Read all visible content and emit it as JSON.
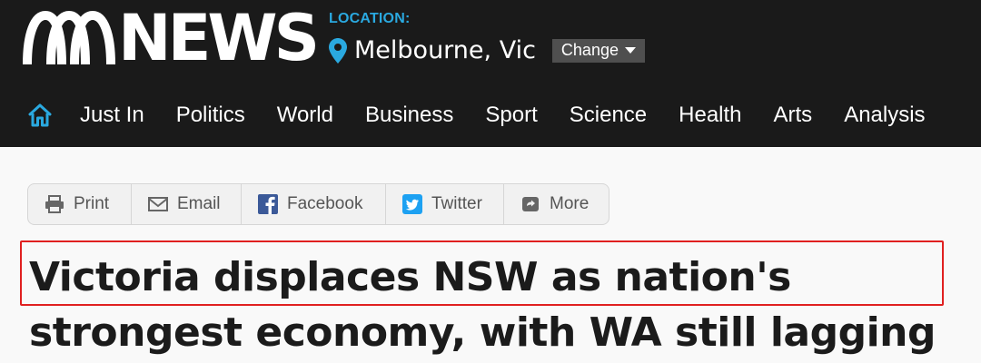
{
  "brand": {
    "logo_text": "NEWS"
  },
  "location": {
    "label": "LOCATION:",
    "city": "Melbourne, Vic",
    "change_label": "Change"
  },
  "nav": {
    "items": [
      "Just In",
      "Politics",
      "World",
      "Business",
      "Sport",
      "Science",
      "Health",
      "Arts",
      "Analysis"
    ]
  },
  "share": {
    "print": "Print",
    "email": "Email",
    "facebook": "Facebook",
    "twitter": "Twitter",
    "more": "More"
  },
  "article": {
    "headline": "Victoria displaces NSW as nation's strongest economy, with WA still lagging"
  },
  "colors": {
    "header_bg": "#1a1a1a",
    "accent": "#2aa9e0",
    "highlight_border": "#e02020",
    "facebook": "#3b5998",
    "twitter": "#1da1f2"
  }
}
